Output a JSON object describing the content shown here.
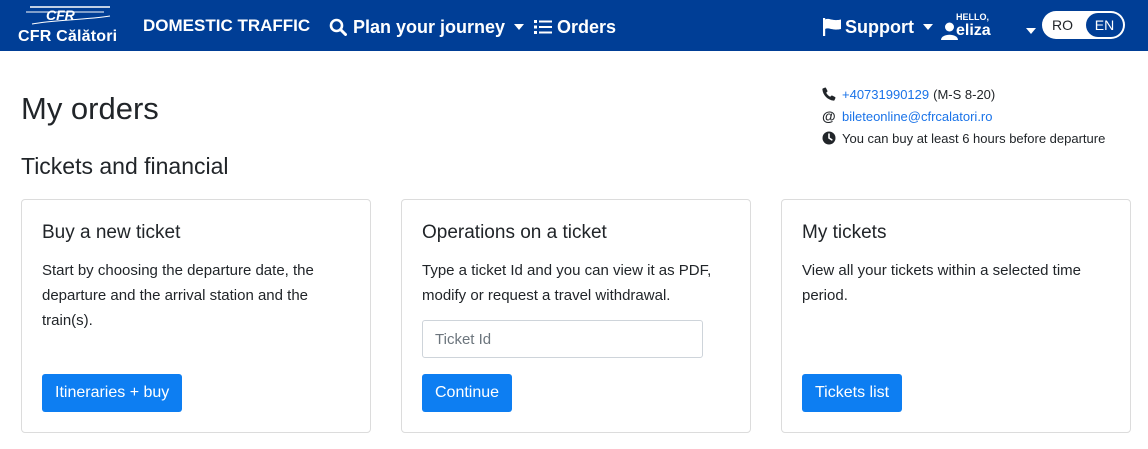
{
  "navbar": {
    "logo": {
      "mark_text": "CFR",
      "name": "CFR Călători"
    },
    "brand": "DOMESTIC TRAFFIC",
    "plan_journey": "Plan your journey",
    "orders": "Orders",
    "support": "Support",
    "user": {
      "greeting": "HELLO,",
      "name": "eliza"
    },
    "language": {
      "options": [
        "RO",
        "EN"
      ],
      "selected": "EN"
    },
    "icons": [
      "search-icon",
      "list-icon",
      "flag-icon",
      "user-icon",
      "chevron-down-icon"
    ],
    "colors": {
      "background": "#003e96",
      "text": "#ffffff"
    }
  },
  "contact": {
    "phone": "+40731990129",
    "phone_hours": "(M-S 8-20)",
    "email": "bileteonline@cfrcalatori.ro",
    "notice": "You can buy at least 6 hours before departure",
    "icons": [
      "phone-icon",
      "at-icon",
      "clock-icon"
    ]
  },
  "page": {
    "title": "My orders",
    "section_title": "Tickets and financial"
  },
  "cards": [
    {
      "title": "Buy a new ticket",
      "text": "Start by choosing the departure date, the departure and the arrival station and the train(s).",
      "button": "Itineraries + buy"
    },
    {
      "title": "Operations on a ticket",
      "text": "Type a ticket Id and you can view it as PDF, modify or request a travel withdrawal.",
      "input_placeholder": "Ticket Id",
      "input_value": "",
      "button": "Continue"
    },
    {
      "title": "My tickets",
      "text": "View all your tickets within a selected time period.",
      "button": "Tickets list"
    }
  ],
  "colors": {
    "primary_button": "#0d7ef2",
    "link": "#1a73e8"
  }
}
